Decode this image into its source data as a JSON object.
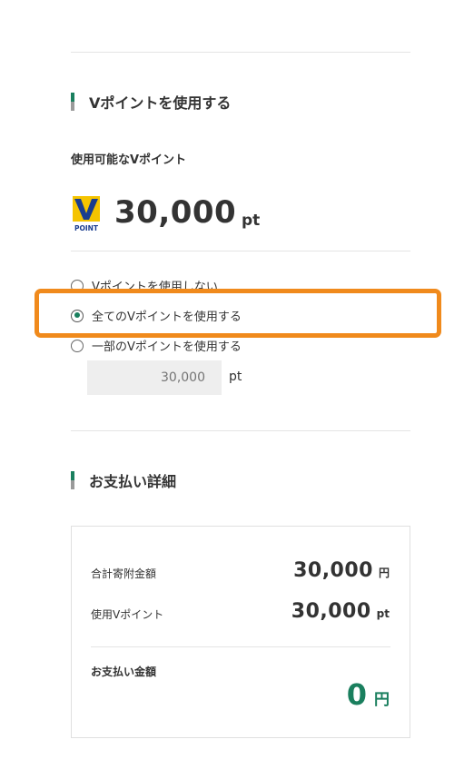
{
  "vpoint_section": {
    "title": "Vポイントを使用する",
    "available_label": "使用可能なVポイント",
    "logo_text": "POINT",
    "points_value": "30,000",
    "points_unit": "pt",
    "options": [
      {
        "label": "Vポイントを使用しない",
        "selected": false
      },
      {
        "label": "全てのVポイントを使用する",
        "selected": true
      },
      {
        "label": "一部のVポイントを使用する",
        "selected": false
      }
    ],
    "partial_input_placeholder": "30,000",
    "partial_unit": "pt"
  },
  "payment_section": {
    "title": "お支払い詳細",
    "rows": [
      {
        "label": "合計寄附金額",
        "value": "30,000",
        "unit": "円"
      },
      {
        "label": "使用Vポイント",
        "value": "30,000",
        "unit": "pt"
      }
    ],
    "total_label": "お支払い金額",
    "total_value": "0",
    "total_unit": "円"
  },
  "colors": {
    "accent": "#1a7f5e",
    "highlight": "#f08a1c",
    "vlogo_yellow": "#f5c400",
    "vlogo_blue": "#1a3d8f"
  }
}
